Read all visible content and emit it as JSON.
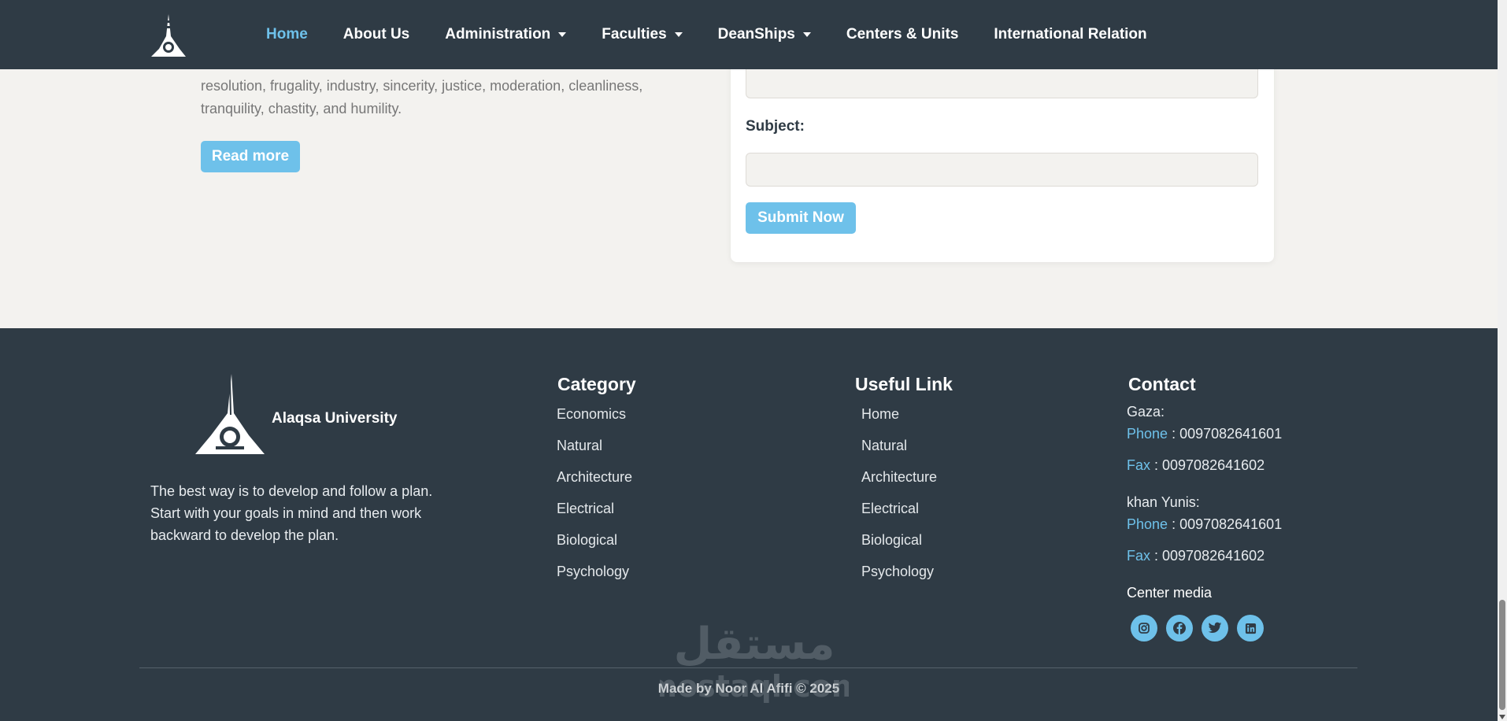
{
  "nav": {
    "items": [
      {
        "label": "Home",
        "active": true
      },
      {
        "label": "About Us"
      },
      {
        "label": "Administration",
        "dropdown": true
      },
      {
        "label": "Faculties",
        "dropdown": true
      },
      {
        "label": "DeanShips",
        "dropdown": true
      },
      {
        "label": "Centers & Units"
      },
      {
        "label": "International Relation"
      }
    ]
  },
  "about": {
    "text_line1": "resolution, frugality, industry, sincerity, justice, moderation, cleanliness,",
    "text_line2": "tranquility, chastity, and humility.",
    "read_more": "Read more"
  },
  "form": {
    "subject_label": "Subject:",
    "submit": "Submit Now"
  },
  "footer": {
    "brand": "Alaqsa University",
    "description": "The best way is to develop and follow a plan. Start with your goals in mind and then work backward to develop the plan.",
    "category": {
      "title": "Category",
      "links": [
        "Economics",
        "Natural",
        "Architecture",
        "Electrical",
        "Biological",
        "Psychology"
      ]
    },
    "useful": {
      "title": "Useful Link",
      "links": [
        "Home",
        "Natural",
        "Architecture",
        "Electrical",
        "Biological",
        "Psychology"
      ]
    },
    "contact": {
      "title": "Contact",
      "gaza": {
        "city": "Gaza:",
        "phone_label": "Phone",
        "phone": " : 0097082641601",
        "fax_label": "Fax",
        "fax": " : 0097082641602"
      },
      "khanyunis": {
        "city": "khan Yunis:",
        "phone_label": "Phone",
        "phone": " : 0097082641601",
        "fax_label": "Fax",
        "fax": " : 0097082641602"
      },
      "center_media": "Center media",
      "socials": [
        "instagram-icon",
        "facebook-icon",
        "twitter-icon",
        "linkedin-icon"
      ]
    },
    "credits": "Made by Noor Al Afifi © 2025"
  },
  "watermark": "مستقل mostaql.com",
  "colors": {
    "navbar": "#2f3b45",
    "accent": "#6ec1ea",
    "page_bg": "#f3f2ef"
  }
}
